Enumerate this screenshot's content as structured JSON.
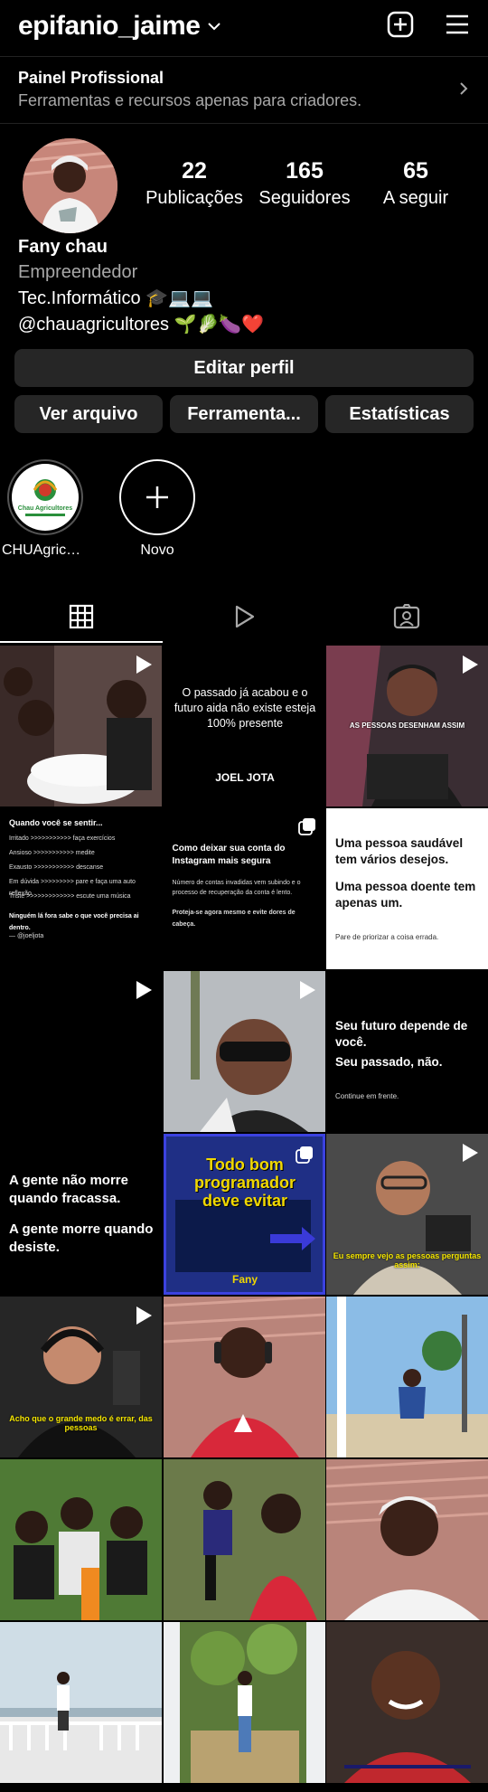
{
  "header": {
    "username": "epifanio_jaime",
    "chevron_icon": "chevron-down-icon",
    "add_icon": "plus-square-icon",
    "menu_icon": "hamburger-menu-icon"
  },
  "pro_panel": {
    "title": "Painel Profissional",
    "subtitle": "Ferramentas e recursos apenas para criadores."
  },
  "profile": {
    "stats": [
      {
        "value": "22",
        "label": "Publicações"
      },
      {
        "value": "165",
        "label": "Seguidores"
      },
      {
        "value": "65",
        "label": "A seguir"
      }
    ],
    "name": "Fany chau",
    "category": "Empreendedor",
    "bio_line1": "Tec.Informático 🎓💻💻",
    "bio_line2": "@chauagricultores 🌱🥬🍆❤️"
  },
  "buttons": {
    "edit_profile": "Editar perfil",
    "archive": "Ver arquivo",
    "tools": "Ferramenta...",
    "insights": "Estatísticas"
  },
  "highlights": [
    {
      "label": "CHUAgricult...",
      "logo_text": "Chau Agricultores"
    },
    {
      "label": "Novo"
    }
  ],
  "tabs": [
    "grid-icon",
    "reels-icon",
    "tagged-icon"
  ],
  "posts": {
    "p2_line1": "O passado já  acabou e o futuro aida não  existe esteja 100% presente",
    "p2_line2": "JOEL JOTA",
    "p3_caption": "AS PESSOAS DESENHAM ASSIM",
    "p4_title": "Quando você se sentir...",
    "p4_lines": [
      "Irritado >>>>>>>>>>> faça exercícios",
      "Ansioso >>>>>>>>>>> medite",
      "Exausto >>>>>>>>>>> descanse",
      "Em dúvida >>>>>>>>> pare e faça uma auto reflexão",
      "Triste >>>>>>>>>>>>> escute uma música",
      "Ninguém lá fora sabe o que você precisa ai dentro.",
      "— @joeljota"
    ],
    "p5_title": "Como deixar sua conta do Instagram mais segura",
    "p5_body": "Número de contas invadidas vem subindo e o processo de recuperação da conta é lento.",
    "p5_body2": "Proteja-se agora mesmo e evite dores de cabeça.",
    "p6_line1": "Uma pessoa saudável tem vários desejos.",
    "p6_line2": "Uma pessoa doente tem apenas um.",
    "p6_line3": "Pare de priorizar a coisa errada.",
    "p9_line1": "Seu futuro depende de você.",
    "p9_line2": "Seu passado, não.",
    "p9_line3": "Continue em frente.",
    "p10_line1": "A gente não morre quando fracassa.",
    "p10_line2": "A gente morre quando desiste.",
    "p11_title": "Todo bom programador deve evitar",
    "p11_footer": "Fany",
    "p12_caption": "Eu sempre vejo as pessoas perguntas assim:",
    "p13_caption": "Acho que o grande medo é errar, das pessoas"
  },
  "colors": {
    "background": "#000000",
    "button_bg": "#262626",
    "secondary_text": "#a8a8a8"
  }
}
